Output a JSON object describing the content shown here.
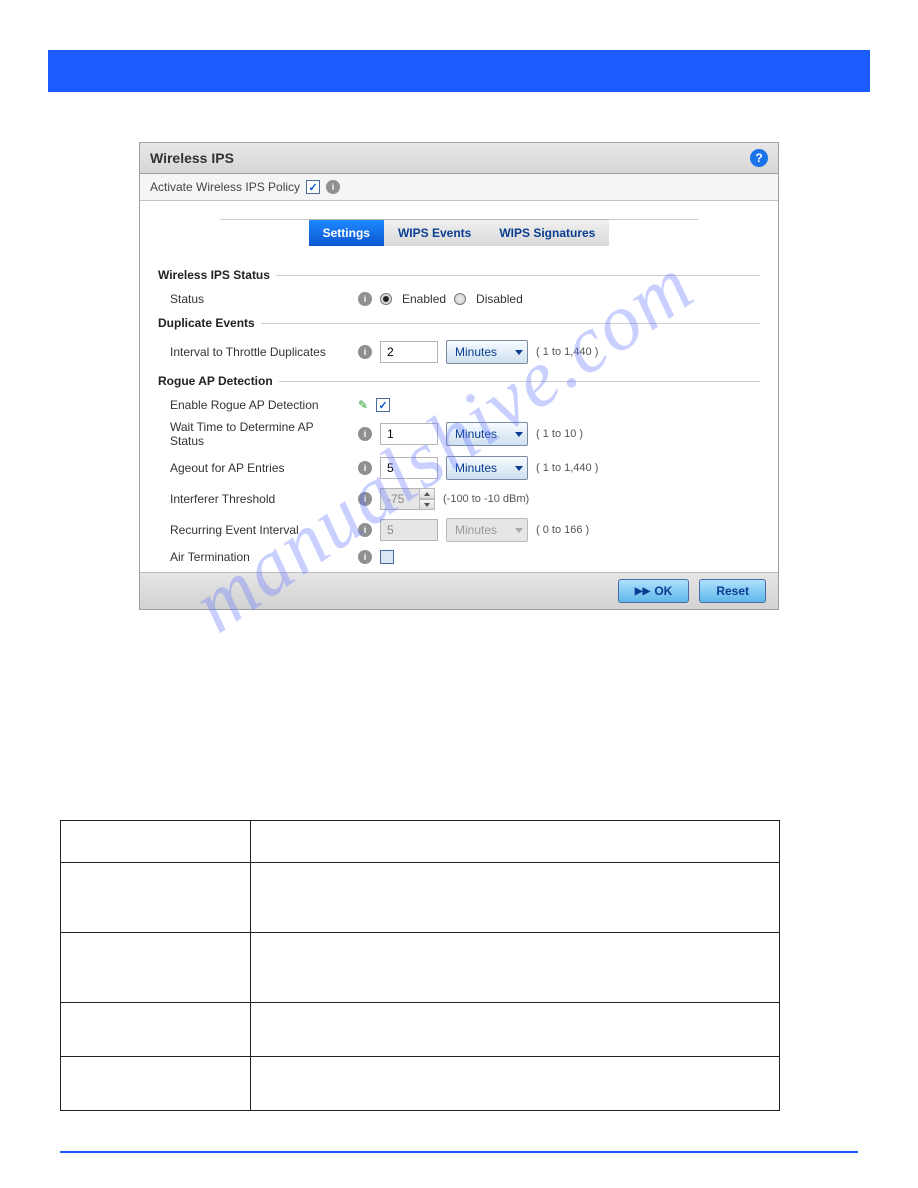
{
  "panel": {
    "title": "Wireless IPS",
    "policy_label": "Activate Wireless IPS Policy",
    "policy_checked": true
  },
  "tabs": [
    {
      "label": "Settings",
      "active": true
    },
    {
      "label": "WIPS Events",
      "active": false
    },
    {
      "label": "WIPS Signatures",
      "active": false
    }
  ],
  "sections": {
    "status": {
      "heading": "Wireless IPS Status",
      "status_label": "Status",
      "enabled_label": "Enabled",
      "disabled_label": "Disabled",
      "selected": "Enabled"
    },
    "duplicate": {
      "heading": "Duplicate Events",
      "interval_label": "Interval to Throttle Duplicates",
      "interval_value": "2",
      "interval_unit": "Minutes",
      "interval_range": "( 1 to 1,440 )"
    },
    "rogue": {
      "heading": "Rogue AP Detection",
      "enable_label": "Enable Rogue AP Detection",
      "enable_checked": true,
      "wait_label": "Wait Time to Determine AP Status",
      "wait_value": "1",
      "wait_unit": "Minutes",
      "wait_range": "( 1 to 10 )",
      "ageout_label": "Ageout for AP Entries",
      "ageout_value": "5",
      "ageout_unit": "Minutes",
      "ageout_range": "( 1 to 1,440 )",
      "interferer_label": "Interferer Threshold",
      "interferer_value": "-75",
      "interferer_range": "(-100 to -10 dBm)",
      "recurring_label": "Recurring Event Interval",
      "recurring_value": "5",
      "recurring_unit": "Minutes",
      "recurring_range": "( 0 to 166 )",
      "airterm_label": "Air Termination",
      "airterm_checked": false
    }
  },
  "footer": {
    "ok": "OK",
    "reset": "Reset"
  },
  "watermark": "manualshive.com"
}
